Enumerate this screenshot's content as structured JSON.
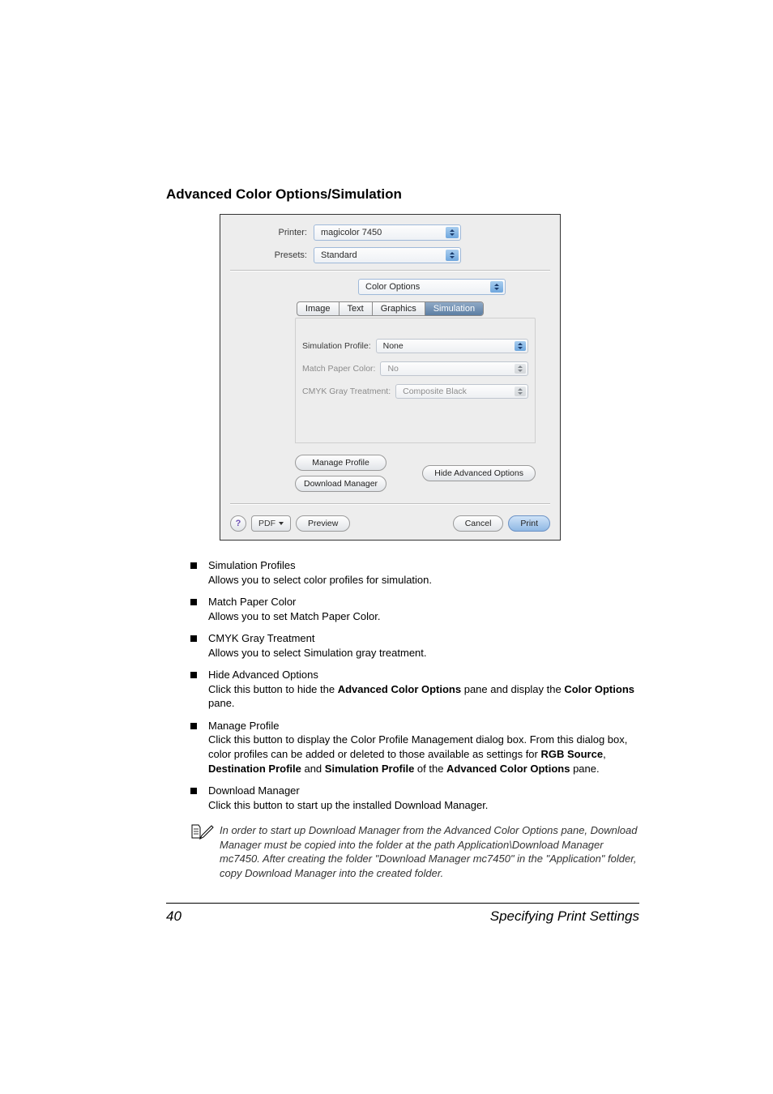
{
  "heading": "Advanced Color Options/Simulation",
  "dialog": {
    "printer_label": "Printer:",
    "printer_value": "magicolor 7450",
    "presets_label": "Presets:",
    "presets_value": "Standard",
    "pane_value": "Color Options",
    "tabs": [
      "Image",
      "Text",
      "Graphics",
      "Simulation"
    ],
    "active_tab": 3,
    "opt_sim_label": "Simulation Profile:",
    "opt_sim_value": "None",
    "opt_match_label": "Match Paper Color:",
    "opt_match_value": "No",
    "opt_gray_label": "CMYK Gray Treatment:",
    "opt_gray_value": "Composite Black",
    "manage_profile": "Manage Profile",
    "download_manager": "Download Manager",
    "hide_advanced": "Hide Advanced Options",
    "help": "?",
    "pdf": "PDF",
    "preview": "Preview",
    "cancel": "Cancel",
    "print": "Print"
  },
  "bullets": [
    {
      "title": "Simulation Profiles",
      "body": "Allows you to select color profiles for simulation."
    },
    {
      "title": "Match Paper Color",
      "body": "Allows you to set Match Paper Color."
    },
    {
      "title": "CMYK Gray Treatment",
      "body": "Allows you to select Simulation gray treatment."
    },
    {
      "title": "Hide Advanced Options",
      "body_parts": [
        "Click this button to hide the ",
        "Advanced Color Options",
        " pane and display the ",
        "Color Options",
        " pane."
      ]
    },
    {
      "title": "Manage Profile",
      "body_parts": [
        "Click this button to display the Color Profile Management dialog box. From this dialog box, color profiles can be added or deleted to those available as settings for ",
        "RGB Source",
        ", ",
        "Destination Profile",
        " and ",
        "Simulation Profile",
        " of the ",
        "Advanced Color Options",
        " pane."
      ]
    },
    {
      "title": "Download Manager",
      "body": "Click this button to start up the installed Download Manager."
    }
  ],
  "note": "In order to start up Download Manager from the Advanced Color Options pane, Download Manager must be copied into the folder at the path Application\\Download Manager mc7450. After creating the folder \"Download Manager mc7450\" in the \"Application\" folder, copy Download Manager into the created folder.",
  "page_number": "40",
  "footer_text": "Specifying Print Settings"
}
